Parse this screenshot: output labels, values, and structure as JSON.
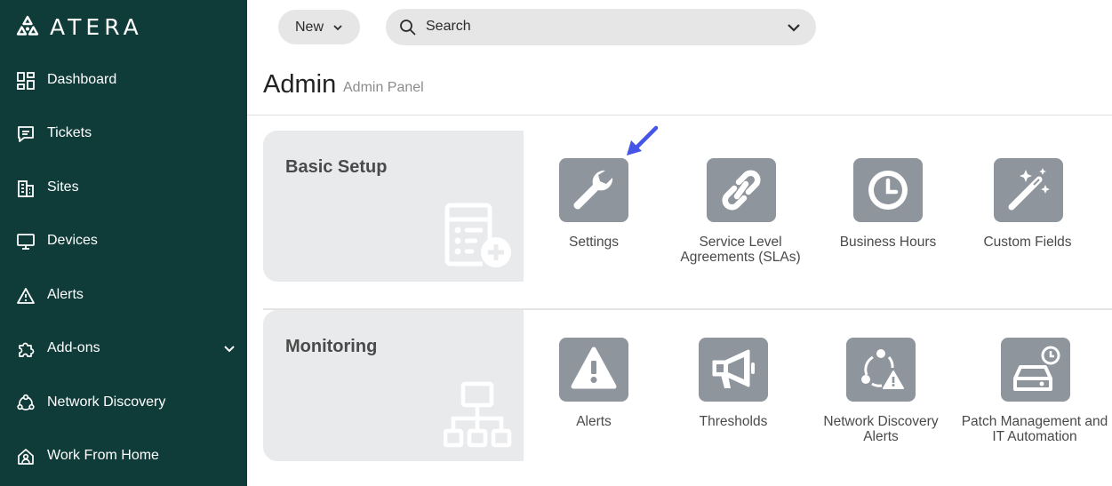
{
  "brand": {
    "name": "ATERA"
  },
  "sidebar": {
    "items": [
      {
        "label": "Dashboard",
        "icon": "dashboard-icon"
      },
      {
        "label": "Tickets",
        "icon": "tickets-icon"
      },
      {
        "label": "Sites",
        "icon": "sites-icon"
      },
      {
        "label": "Devices",
        "icon": "devices-icon"
      },
      {
        "label": "Alerts",
        "icon": "alerts-icon"
      },
      {
        "label": "Add-ons",
        "icon": "addons-icon",
        "expandable": true
      },
      {
        "label": "Network Discovery",
        "icon": "network-discovery-icon"
      },
      {
        "label": "Work From Home",
        "icon": "work-from-home-icon"
      }
    ]
  },
  "toolbar": {
    "new_label": "New",
    "search_placeholder": "Search"
  },
  "header": {
    "title": "Admin",
    "subtitle": "Admin Panel"
  },
  "sections": [
    {
      "title": "Basic Setup",
      "tiles": [
        {
          "label": "Settings",
          "icon": "wrench-icon"
        },
        {
          "label": "Service Level Agreements (SLAs)",
          "icon": "link-icon"
        },
        {
          "label": "Business Hours",
          "icon": "clock-icon"
        },
        {
          "label": "Custom Fields",
          "icon": "magic-wand-icon"
        }
      ]
    },
    {
      "title": "Monitoring",
      "tiles": [
        {
          "label": "Alerts",
          "icon": "warning-icon"
        },
        {
          "label": "Thresholds",
          "icon": "megaphone-icon"
        },
        {
          "label": "Network Discovery Alerts",
          "icon": "network-alert-icon"
        },
        {
          "label": "Patch Management and IT Automation",
          "icon": "patch-management-icon"
        }
      ]
    }
  ],
  "colors": {
    "sidebar_bg": "#0f3b39",
    "tile_bg": "#8e959c",
    "section_bg": "#e8eaec",
    "annotation_arrow": "#4455e8"
  }
}
